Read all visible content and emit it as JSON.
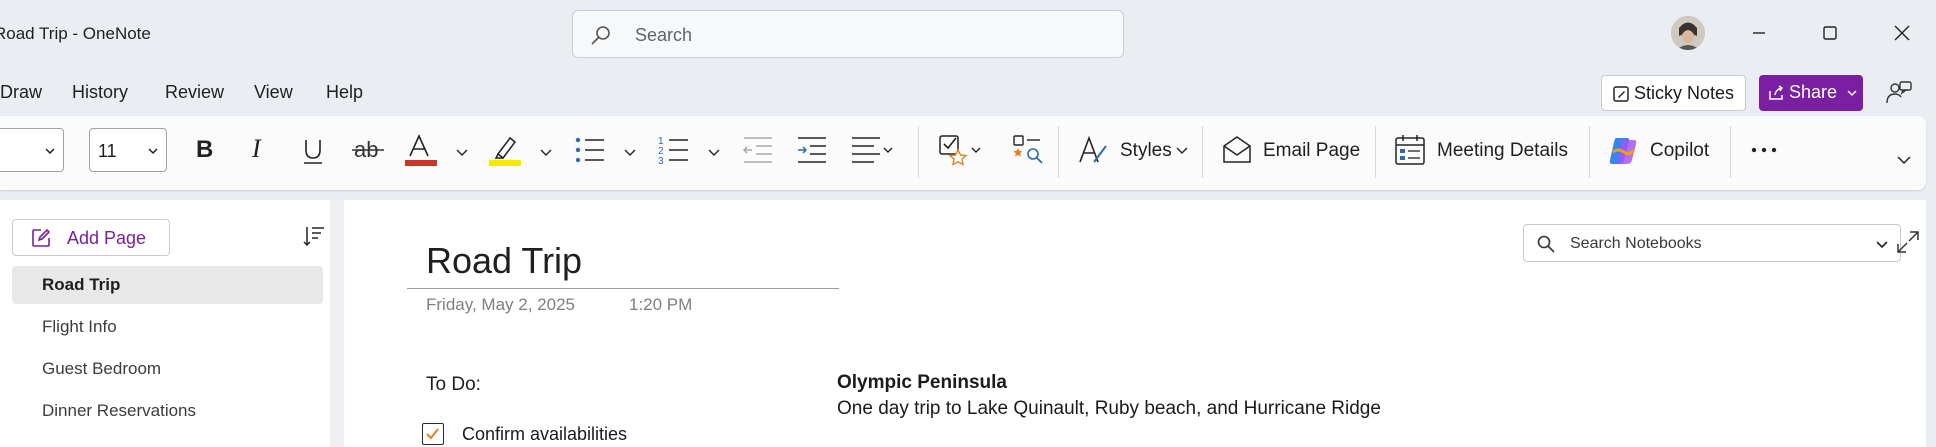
{
  "window": {
    "title": "Road Trip  -  OneNote",
    "search_placeholder": "Search"
  },
  "menu": {
    "items": [
      "Draw",
      "History",
      "Review",
      "View",
      "Help"
    ],
    "sticky_notes": "Sticky Notes",
    "share": "Share"
  },
  "ribbon": {
    "font_name": "",
    "font_size": "11",
    "styles": "Styles",
    "email_page": "Email Page",
    "meeting_details": "Meeting Details",
    "copilot": "Copilot"
  },
  "sidebar": {
    "add_page": "Add Page",
    "pages": [
      {
        "label": "Road Trip",
        "active": true
      },
      {
        "label": "Flight Info",
        "active": false
      },
      {
        "label": "Guest Bedroom",
        "active": false
      },
      {
        "label": "Dinner Reservations",
        "active": false
      }
    ]
  },
  "page": {
    "title": "Road Trip",
    "date": "Friday, May 2, 2025",
    "time": "1:20 PM",
    "todo_heading": "To Do:",
    "todo_items": [
      {
        "label": "Confirm availabilities",
        "checked": true
      }
    ],
    "note_title": "Olympic Peninsula",
    "note_body": "One day trip to Lake Quinault, Ruby beach, and Hurricane Ridge"
  },
  "notebook_search": {
    "placeholder": "Search Notebooks"
  },
  "colors": {
    "accent": "#7a1fa2",
    "font_color": "#c0392b",
    "highlight": "#f5e900",
    "list_icon": "#2b6cb0",
    "check_star": "#e67e22"
  }
}
